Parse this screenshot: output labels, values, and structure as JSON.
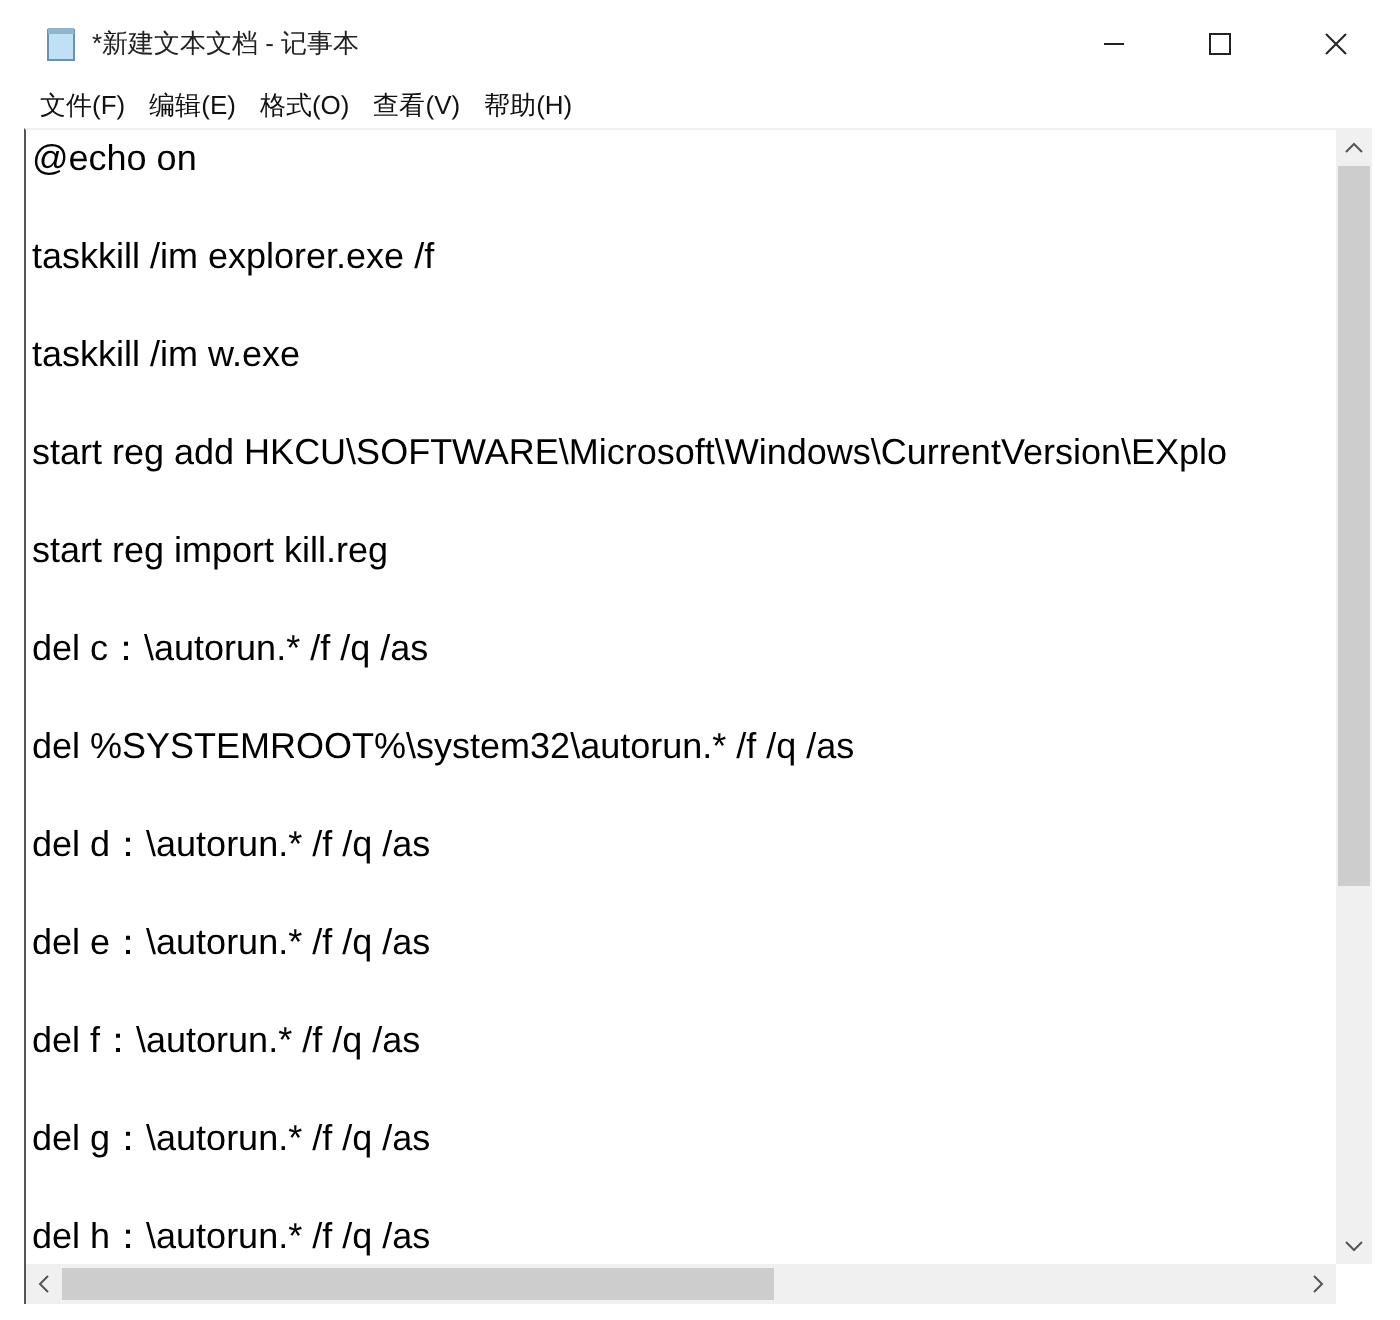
{
  "window": {
    "title": "*新建文本文档 - 记事本"
  },
  "menu": [
    "文件(F)",
    "编辑(E)",
    "格式(O)",
    "查看(V)",
    "帮助(H)"
  ],
  "lines": [
    "@echo on",
    "taskkill /im explorer.exe /f",
    "taskkill /im w.exe",
    "start reg add HKCU\\SOFTWARE\\Microsoft\\Windows\\CurrentVersion\\EXplo",
    "start reg import kill.reg",
    "del c：\\autorun.* /f /q /as",
    "del %SYSTEMROOT%\\system32\\autorun.* /f /q /as",
    "del d：\\autorun.* /f /q /as",
    "del e：\\autorun.* /f /q /as",
    "del f：\\autorun.* /f /q /as",
    "del g：\\autorun.* /f /q /as",
    "del h：\\autorun.* /f /q /as"
  ]
}
